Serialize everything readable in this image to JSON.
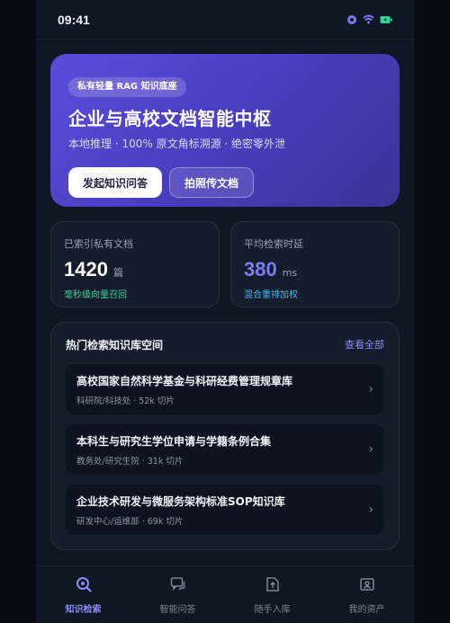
{
  "status_bar": {
    "time": "09:41"
  },
  "hero": {
    "badge": "私有轻量 RAG 知识底座",
    "title": "企业与高校文档智能中枢",
    "subtitle": "本地推理 · 100% 原文角标溯源 · 绝密零外泄",
    "primary_button": "发起知识问答",
    "secondary_button": "拍照传文档"
  },
  "stats": [
    {
      "label": "已索引私有文档",
      "value": "1420",
      "unit": "篇",
      "note": "毫秒级向量召回"
    },
    {
      "label": "平均检索时延",
      "value": "380",
      "unit": "ms",
      "note": "混合重排加权"
    }
  ],
  "knowledge_bases": {
    "title": "热门检索知识库空间",
    "view_all": "查看全部",
    "items": [
      {
        "title": "高校国家自然科学基金与科研经费管理规章库",
        "meta": "科研院/科技处 · 52k 切片"
      },
      {
        "title": "本科生与研究生学位申请与学籍条例合集",
        "meta": "教务处/研究生院 · 31k 切片"
      },
      {
        "title": "企业技术研发与微服务架构标准SOP知识库",
        "meta": "研发中心/运维部 · 69k 切片"
      }
    ]
  },
  "tabs": [
    {
      "label": "知识检索",
      "icon": "search-icon",
      "active": true
    },
    {
      "label": "智能问答",
      "icon": "chat-icon",
      "active": false
    },
    {
      "label": "随手入库",
      "icon": "upload-icon",
      "active": false
    },
    {
      "label": "我的资产",
      "icon": "profile-icon",
      "active": false
    }
  ],
  "colors": {
    "accent": "#7b7cf5",
    "hero_gradient_start": "#5b4ddb",
    "hero_gradient_end": "#3a3396",
    "success": "#34d399",
    "info": "#38bdf8"
  }
}
